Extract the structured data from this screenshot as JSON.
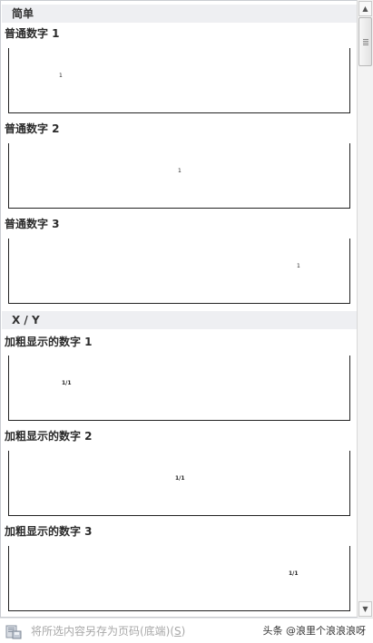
{
  "categories": [
    {
      "title": "简单"
    },
    {
      "title": "X / Y"
    }
  ],
  "items": [
    {
      "label": "普通数字 1",
      "number": "1"
    },
    {
      "label": "普通数字 2",
      "number": "1"
    },
    {
      "label": "普通数字 3",
      "number": "1"
    },
    {
      "label": "加粗显示的数字 1",
      "number": "1/1"
    },
    {
      "label": "加粗显示的数字 2",
      "number": "1/1"
    },
    {
      "label": "加粗显示的数字 3",
      "number": "1/1"
    }
  ],
  "footer": {
    "save_label": "将所选内容另存为页码(底端)(",
    "save_accel": "S",
    "save_close": ")",
    "watermark": "头条 @浪里个浪浪浪呀"
  },
  "scrollbar": {
    "up": "▲",
    "down": "▼"
  }
}
